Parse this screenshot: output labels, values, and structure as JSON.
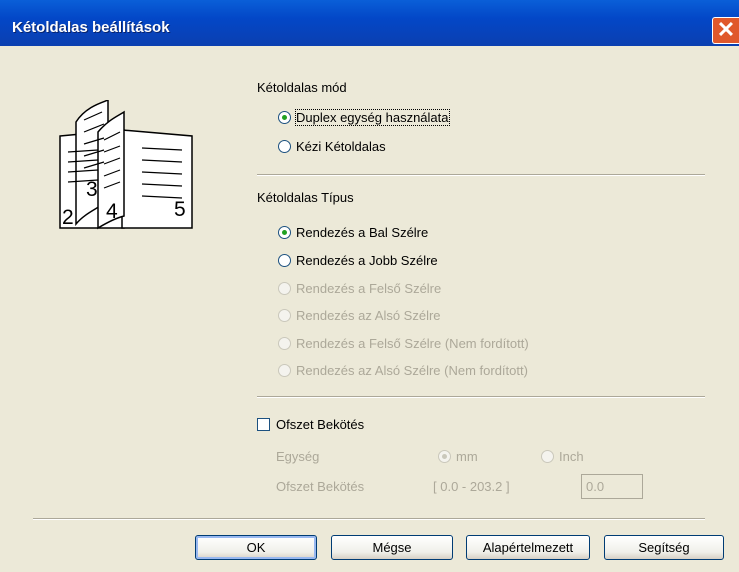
{
  "window": {
    "title": "Kétoldalas beállítások",
    "close_label": "✕"
  },
  "duplex_mode": {
    "label": "Kétoldalas mód",
    "options": [
      "Duplex egység használata",
      "Kézi Kétoldalas"
    ]
  },
  "duplex_type": {
    "label": "Kétoldalas Típus",
    "options": [
      "Rendezés a Bal Szélre",
      "Rendezés a Jobb Szélre",
      "Rendezés a Felső Szélre",
      "Rendezés az Alsó Szélre",
      "Rendezés a Felső Szélre (Nem fordított)",
      "Rendezés az Alsó Szélre (Nem fordított)"
    ]
  },
  "offset": {
    "checkbox_label": "Ofszet Bekötés",
    "unit_label": "Egység",
    "unit_options": [
      "mm",
      "Inch"
    ],
    "value_label": "Ofszet Bekötés",
    "range": "[ 0.0 - 203.2 ]",
    "value": "0.0"
  },
  "illustration": {
    "page_numbers": [
      "3",
      "2",
      "4",
      "5"
    ]
  },
  "buttons": {
    "ok": "OK",
    "cancel": "Mégse",
    "default": "Alapértelmezett",
    "help": "Segítség"
  }
}
